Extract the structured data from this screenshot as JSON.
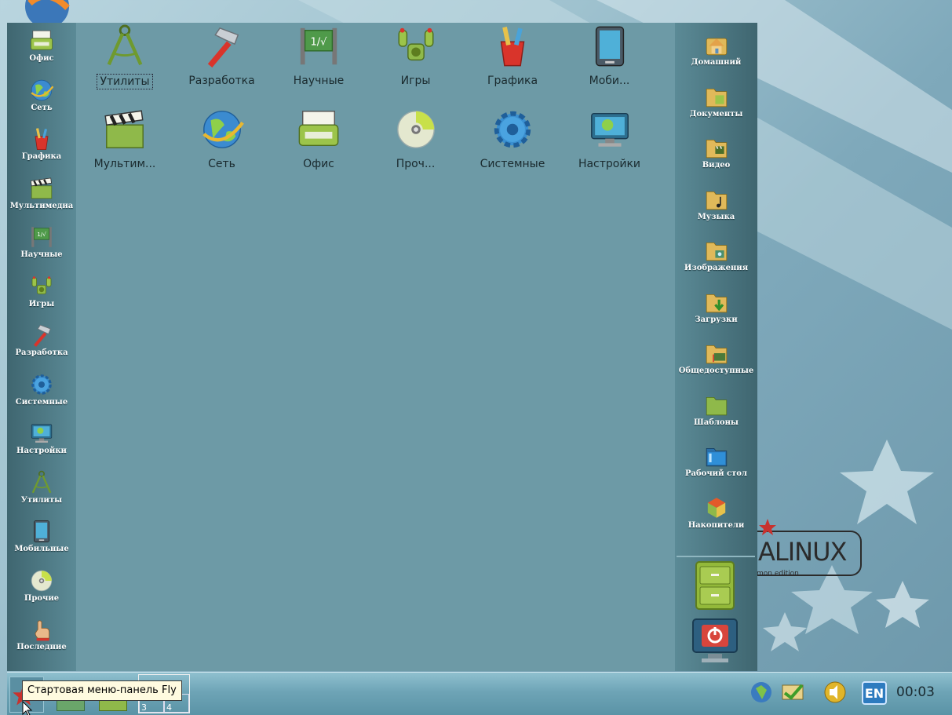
{
  "colors": {
    "panel": "#6d9aa6",
    "side_panel": "#4d7a86",
    "taskbar": "#6ea4b6",
    "tooltip_bg": "#fffbe0",
    "lang_badge": "#2d7bbf"
  },
  "brand": {
    "text": "ALINUX",
    "subtitle": "mon edition"
  },
  "left_sidebar": [
    {
      "label": "Офис",
      "icon": "typewriter-icon"
    },
    {
      "label": "Сеть",
      "icon": "globe-icon"
    },
    {
      "label": "Графика",
      "icon": "paint-brushes-icon"
    },
    {
      "label": "Мультимедиа",
      "icon": "clapperboard-icon"
    },
    {
      "label": "Научные",
      "icon": "chalkboard-icon"
    },
    {
      "label": "Игры",
      "icon": "joystick-icon"
    },
    {
      "label": "Разработка",
      "icon": "hammer-icon"
    },
    {
      "label": "Системные",
      "icon": "gear-icon"
    },
    {
      "label": "Настройки",
      "icon": "monitor-settings-icon"
    },
    {
      "label": "Утилиты",
      "icon": "compass-icon"
    },
    {
      "label": "Мобильные",
      "icon": "tablet-icon"
    },
    {
      "label": "Прочие",
      "icon": "cd-icon"
    },
    {
      "label": "Последние",
      "icon": "pointing-hand-icon"
    }
  ],
  "grid": [
    {
      "label": "Утилиты",
      "icon": "compass-icon"
    },
    {
      "label": "Разработка",
      "icon": "hammer-icon"
    },
    {
      "label": "Научные",
      "icon": "chalkboard-icon"
    },
    {
      "label": "Игры",
      "icon": "joystick-icon"
    },
    {
      "label": "Графика",
      "icon": "paint-brushes-icon"
    },
    {
      "label": "Моби...",
      "icon": "tablet-icon"
    },
    {
      "label": "Мультим...",
      "icon": "clapperboard-icon"
    },
    {
      "label": "Сеть",
      "icon": "globe-icon"
    },
    {
      "label": "Офис",
      "icon": "typewriter-icon"
    },
    {
      "label": "Проч...",
      "icon": "cd-icon"
    },
    {
      "label": "Системные",
      "icon": "gear-icon"
    },
    {
      "label": "Настройки",
      "icon": "monitor-settings-icon"
    }
  ],
  "right_sidebar": [
    {
      "label": "Домашний",
      "icon": "home-folder-icon"
    },
    {
      "label": "Документы",
      "icon": "documents-folder-icon"
    },
    {
      "label": "Видео",
      "icon": "video-folder-icon"
    },
    {
      "label": "Музыка",
      "icon": "music-folder-icon"
    },
    {
      "label": "Изображения",
      "icon": "pictures-folder-icon"
    },
    {
      "label": "Загрузки",
      "icon": "downloads-folder-icon"
    },
    {
      "label": "Общедоступные",
      "icon": "public-folder-icon"
    },
    {
      "label": "Шаблоны",
      "icon": "templates-folder-icon"
    },
    {
      "label": "Рабочий стол",
      "icon": "desktop-folder-icon"
    },
    {
      "label": "Накопители",
      "icon": "drives-icon"
    }
  ],
  "taskbar": {
    "tooltip": "Стартовая меню-панель Fly",
    "desktops": [
      "3",
      "4"
    ],
    "lang": "EN",
    "clock": "00:03"
  }
}
